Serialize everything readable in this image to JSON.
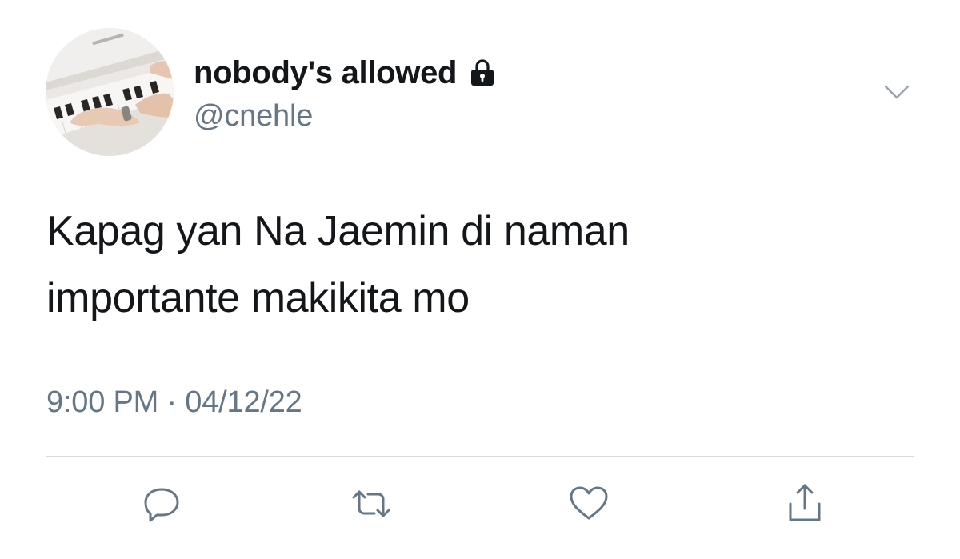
{
  "tweet": {
    "display_name": "nobody's allowed",
    "handle": "@cnehle",
    "text_lines": [
      "Kapag yan Na Jaemin di naman",
      "importante makikita mo"
    ],
    "timestamp": "9:00 PM · 04/12/22",
    "protected_icon": "lock-icon",
    "menu_icon": "chevron-down-icon"
  },
  "actions": {
    "reply_icon": "reply-icon",
    "retweet_icon": "retweet-icon",
    "like_icon": "heart-icon",
    "share_icon": "share-icon"
  },
  "colors": {
    "text": "#14171a",
    "secondary": "#657786",
    "icon": "#657786",
    "divider": "#d6dbdf"
  }
}
